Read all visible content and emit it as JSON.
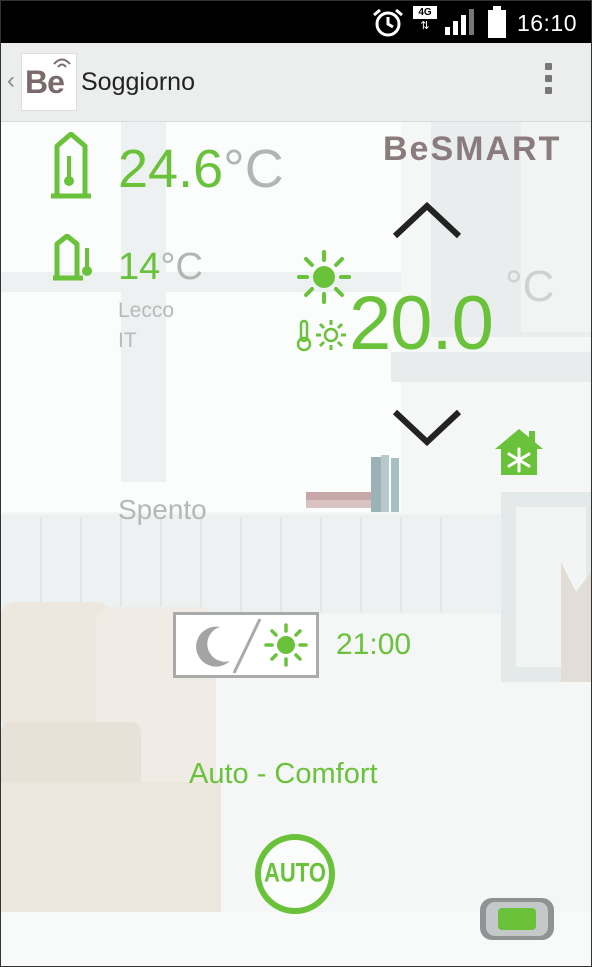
{
  "status_bar": {
    "time": "16:10",
    "network": "4G",
    "icons": [
      "alarm-icon",
      "network-4g-icon",
      "signal-icon",
      "battery-icon"
    ]
  },
  "header": {
    "logo_text": "Be",
    "title": "Soggiorno"
  },
  "brand": {
    "name": "BeSMART"
  },
  "indoor": {
    "temperature": "24.6",
    "unit": "°C"
  },
  "outdoor": {
    "temperature": "14",
    "unit": "°C",
    "city": "Lecco",
    "country": "IT"
  },
  "setpoint": {
    "value": "20.0",
    "unit": "°C",
    "mode_icon": "sun-icon"
  },
  "status": {
    "text": "Spento"
  },
  "schedule": {
    "time": "21:00"
  },
  "mode": {
    "label": "Auto - Comfort",
    "button_label": "AUTO"
  },
  "colors": {
    "accent": "#6ac23a",
    "muted": "#b8baba",
    "brand": "#8a7b7d"
  }
}
